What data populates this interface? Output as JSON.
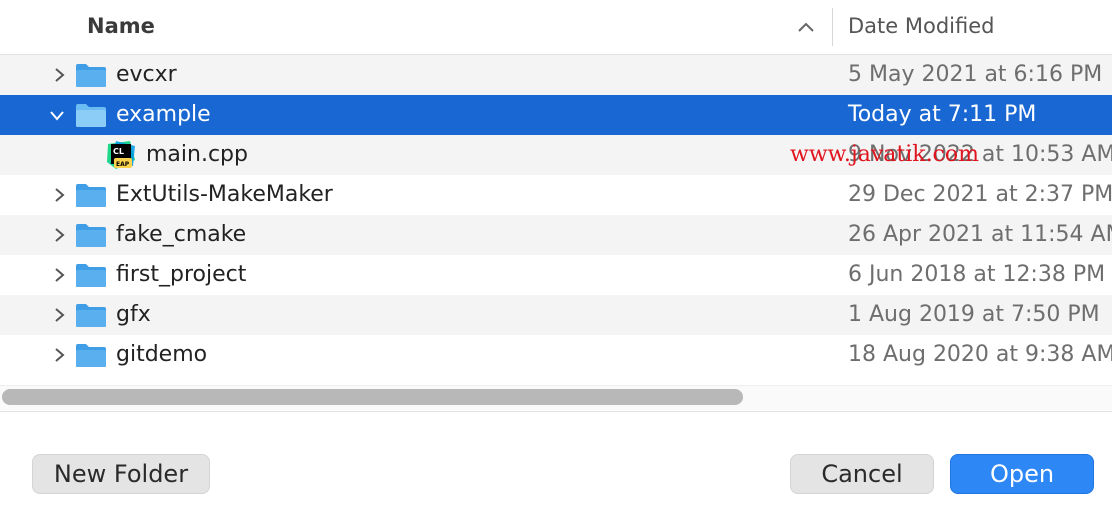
{
  "header": {
    "name_label": "Name",
    "date_label": "Date Modified"
  },
  "rows": [
    {
      "name": "evcxr",
      "date": "5 May 2021 at 6:16 PM"
    },
    {
      "name": "example",
      "date": "Today at 7:11 PM"
    },
    {
      "name": "main.cpp",
      "date": "9 Nov 2022 at 10:53 AM"
    },
    {
      "name": "ExtUtils-MakeMaker",
      "date": "29 Dec 2021 at 2:37 PM"
    },
    {
      "name": "fake_cmake",
      "date": "26 Apr 2021 at 11:54 AM"
    },
    {
      "name": "first_project",
      "date": "6 Jun 2018 at 12:38 PM"
    },
    {
      "name": "gfx",
      "date": "1 Aug 2019 at 7:50 PM"
    },
    {
      "name": "gitdemo",
      "date": "18 Aug 2020 at 9:38 AM"
    }
  ],
  "file_icon_text": {
    "top": "CL",
    "bottom": "EAP"
  },
  "watermark": "www.javatik.com",
  "buttons": {
    "new_folder": "New Folder",
    "cancel": "Cancel",
    "open": "Open"
  },
  "colors": {
    "selection": "#1967d2",
    "folder": "#5ab0ef",
    "primary_button": "#2d87f5",
    "watermark": "#e0141e"
  },
  "icons": {
    "folder": "folder-icon",
    "expand": "chevron-right-icon",
    "collapse": "chevron-down-icon",
    "sort": "chevron-up-icon",
    "cpp_file": "clion-file-icon"
  }
}
